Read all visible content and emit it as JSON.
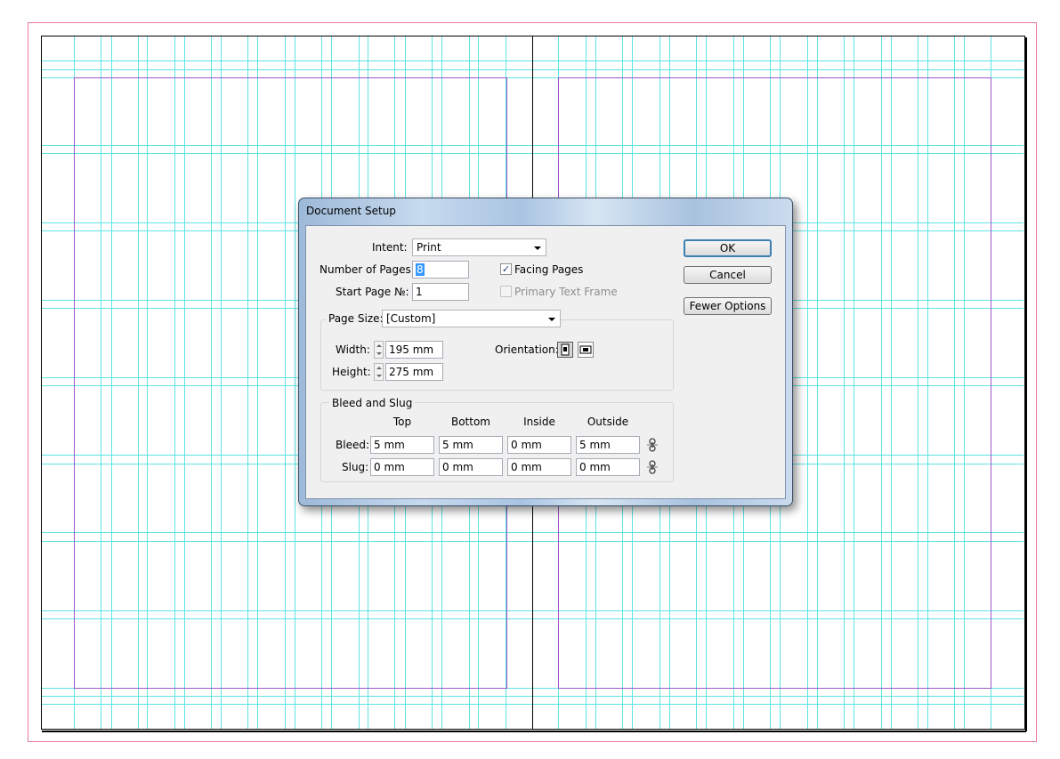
{
  "colors": {
    "guide": "#5de3e3",
    "margin": "#a055c8",
    "bleed": "#e67b9c",
    "page_edge": "#000000",
    "dialog_accent": "#3c7fb1"
  },
  "dialog": {
    "title": "Document Setup",
    "intent_label": "Intent:",
    "intent_value": "Print",
    "pages_label": "Number of Pages:",
    "pages_value": "8",
    "start_label": "Start Page №:",
    "start_value": "1",
    "facing_pages_label": "Facing Pages",
    "facing_pages_checked": true,
    "primary_frame_label": "Primary Text Frame",
    "primary_frame_checked": false,
    "page_size_label": "Page Size:",
    "page_size_value": "[Custom]",
    "width_label": "Width:",
    "width_value": "195 mm",
    "height_label": "Height:",
    "height_value": "275 mm",
    "orientation_label": "Orientation:",
    "orientation_selected": "portrait",
    "bleed_slug_title": "Bleed and Slug",
    "columns": [
      "Top",
      "Bottom",
      "Inside",
      "Outside"
    ],
    "bleed_label": "Bleed:",
    "bleed_values": [
      "5 mm",
      "5 mm",
      "0 mm",
      "5 mm"
    ],
    "slug_label": "Slug:",
    "slug_values": [
      "0 mm",
      "0 mm",
      "0 mm",
      "0 mm"
    ],
    "ok_label": "OK",
    "cancel_label": "Cancel",
    "fewer_options_label": "Fewer Options",
    "link_icon": "chain-link-icon"
  }
}
